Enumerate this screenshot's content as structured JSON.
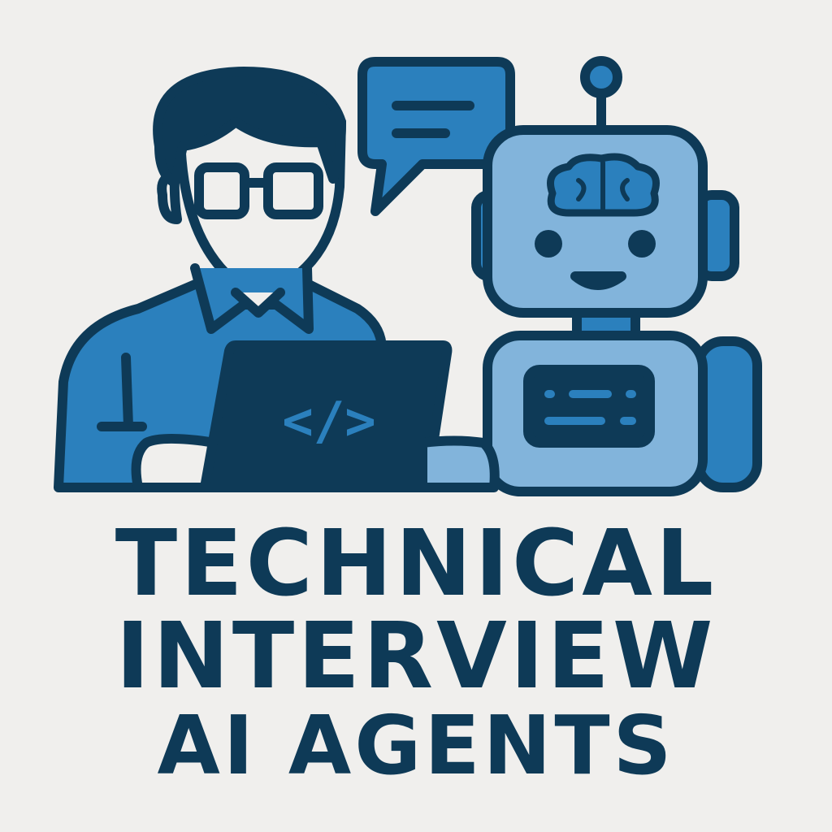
{
  "title": {
    "line1": "TECHNICAL",
    "line2": "INTERVIEW",
    "line3": "AI AGENTS"
  },
  "illustration": {
    "code_symbol": "</>",
    "icons": [
      "person-with-glasses",
      "speech-bubble",
      "laptop",
      "robot",
      "brain"
    ]
  },
  "colors": {
    "background": "#f0efed",
    "navy": "#0e3a57",
    "blue": "#2b80bd",
    "light_blue": "#82b4db"
  }
}
